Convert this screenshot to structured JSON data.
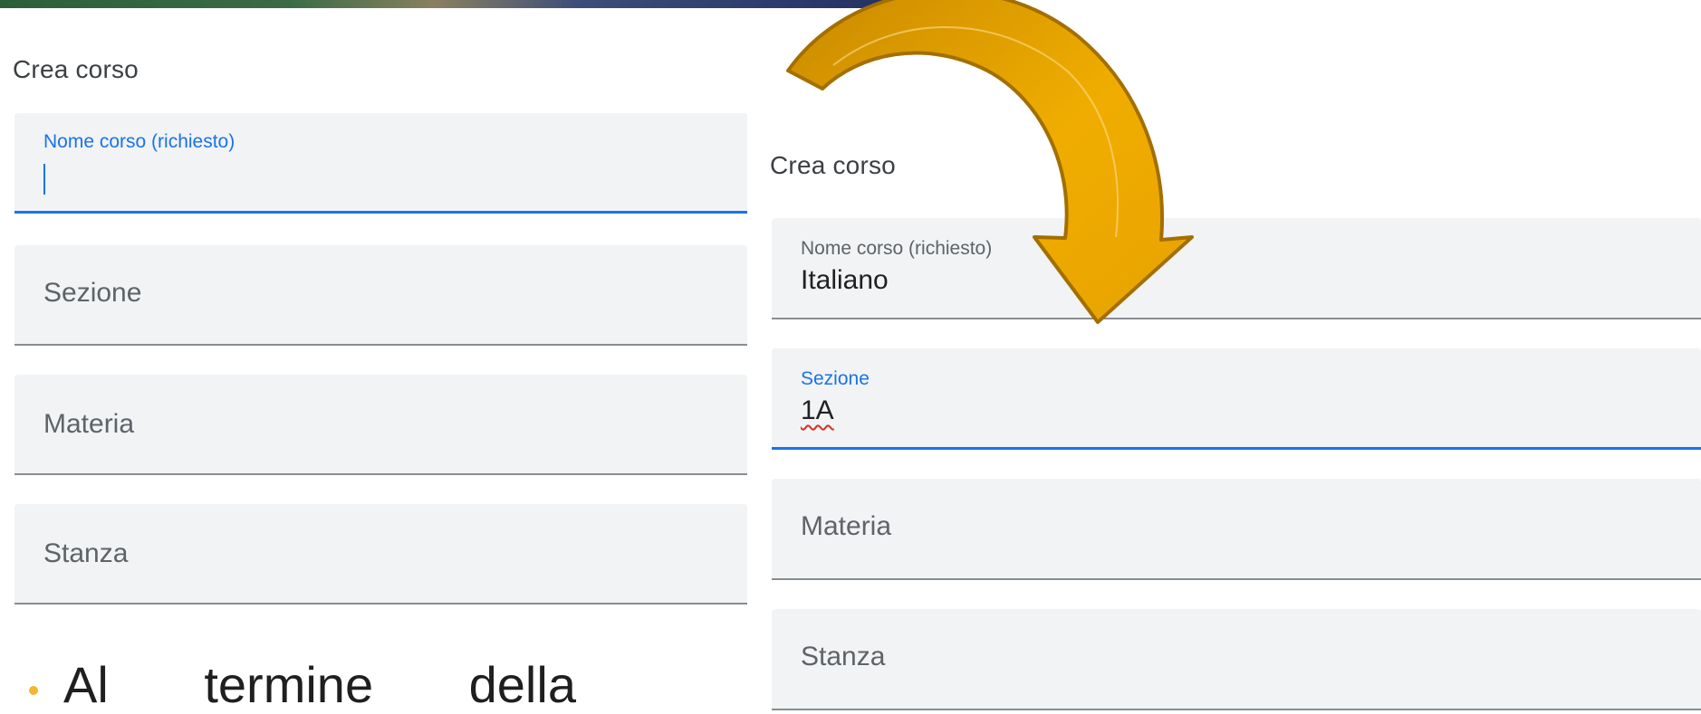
{
  "left_dialog": {
    "title": "Crea corso",
    "fields": [
      {
        "label": "Nome corso (richiesto)",
        "value": ""
      },
      {
        "placeholder": "Sezione"
      },
      {
        "placeholder": "Materia"
      },
      {
        "placeholder": "Stanza"
      }
    ]
  },
  "right_dialog": {
    "title": "Crea corso",
    "fields": [
      {
        "label": "Nome corso (richiesto)",
        "value": "Italiano"
      },
      {
        "label": "Sezione",
        "value": "1A"
      },
      {
        "placeholder": "Materia"
      },
      {
        "placeholder": "Stanza"
      }
    ]
  },
  "bullet": {
    "text": "Al termine della"
  },
  "colors": {
    "focus": "#1a73e8",
    "field_bg": "#f1f3f4",
    "arrow_fill": "#e8a300",
    "arrow_stroke": "#a36f00",
    "bullet": "#f2b632"
  },
  "icons": {
    "arrow": "curved-arrow-icon"
  }
}
